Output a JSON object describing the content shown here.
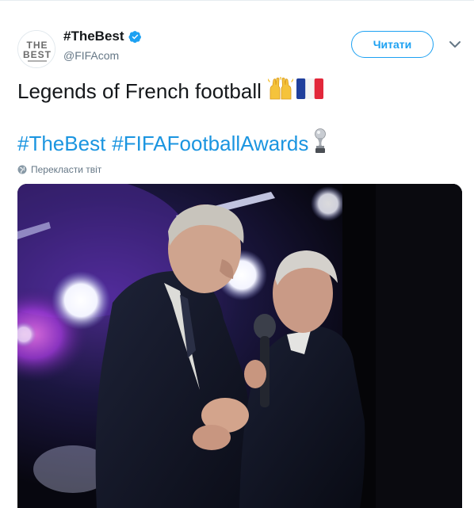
{
  "header": {
    "display_name": "#TheBest",
    "handle": "@FIFAcom",
    "verified": true,
    "avatar_icon": "the-best-fifa-logo",
    "follow_label": "Читати",
    "menu_icon": "chevron-down-icon"
  },
  "tweet": {
    "line1_text": "Legends of French football",
    "line1_emojis": [
      "raising-hands-emoji",
      "france-flag-emoji"
    ],
    "hashtag1": "#TheBest",
    "hashtag2": "#FIFAFootballAwards",
    "line2_emoji": "trophy-emoji"
  },
  "translate": {
    "icon": "globe-icon",
    "label": "Перекласти твіт"
  },
  "media": {
    "type": "photo",
    "subject": "two-men-on-stage-handshake"
  },
  "colors": {
    "accent": "#1da1f2",
    "hashtag": "#1b95e0",
    "text": "#14171a",
    "secondary": "#657786"
  }
}
